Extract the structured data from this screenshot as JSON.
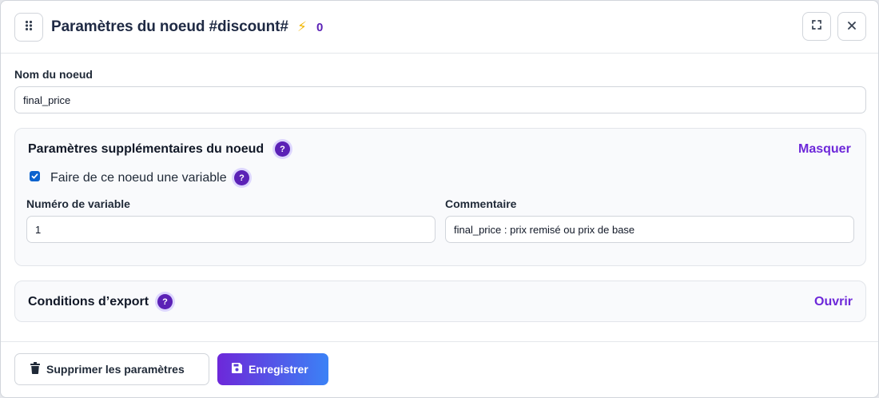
{
  "header": {
    "title": "Paramètres du noeud #discount#",
    "count": "0",
    "icons": [
      "drag-handle-icon",
      "bolt-icon",
      "expand-icon",
      "close-icon"
    ],
    "accent_color": "#5b21b6"
  },
  "node_name": {
    "label": "Nom du noeud",
    "value": "final_price"
  },
  "extra_params": {
    "title": "Paramètres supplémentaires du noeud",
    "toggle_label": "Masquer",
    "help_icon": "?",
    "checkbox_label": "Faire de ce noeud une variable",
    "checkbox_checked": true,
    "variable_number_label": "Numéro de variable",
    "variable_number_value": "1",
    "comment_label": "Commentaire",
    "comment_value": "final_price : prix remisé ou prix de base"
  },
  "export_conditions": {
    "title": "Conditions d’export",
    "toggle_label": "Ouvrir",
    "help_icon": "?"
  },
  "footer": {
    "delete_label": "Supprimer les paramètres",
    "save_label": "Enregistrer",
    "delete_icon": "trash-icon",
    "save_icon": "save-icon",
    "save_gradient": [
      "#6d28d9",
      "#3b82f6"
    ]
  }
}
